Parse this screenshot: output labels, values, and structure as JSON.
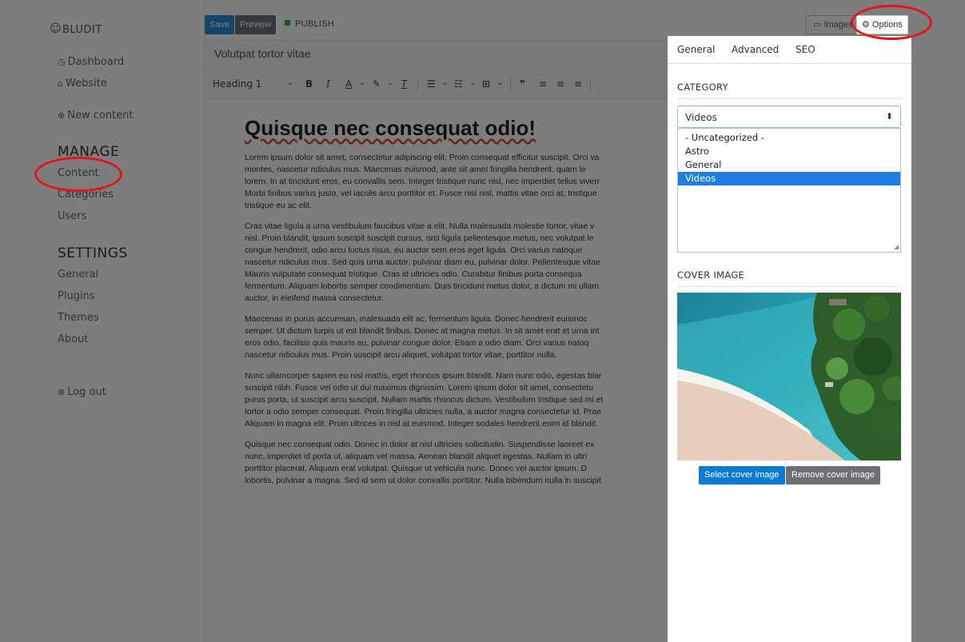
{
  "sidebar": {
    "brand": "BLUDIT",
    "dashboard": "Dashboard",
    "website": "Website",
    "new_content": "New content",
    "manage_heading": "MANAGE",
    "content": "Content",
    "categories": "Categories",
    "users": "Users",
    "settings_heading": "SETTINGS",
    "general": "General",
    "plugins": "Plugins",
    "themes": "Themes",
    "about": "About",
    "logout": "Log out"
  },
  "editor": {
    "save_label": "Save",
    "preview_label": "Preview",
    "publish_label": "PUBLISH",
    "title_value": "Volutpat tortor vitae",
    "heading_format": "Heading 1",
    "doc_heading": "Quisque nec consequat odio!",
    "paragraphs": [
      [
        "Lorem ipsum dolor sit amet, consectetur adipiscing elit. Proin consequat efficitur suscipit. Orci va",
        "montes, nascetur ridiculus mus. Maecenas euismod, ante sit amet fringilla hendrerit, quam le",
        "lorem. In at tincidunt eros, eu convallis sem. Integer tristique nunc nisl, nec imperdiet tellus viverr",
        "Morbi finibus varius justo, vel iaculis arcu porttitor et. Fusce nisi nisl, mattis vitae orci at, tristique",
        "tristique eu ac elit."
      ],
      [
        "Cras vitae ligula a urna vestibulum faucibus vitae a elit. Nulla malesuada molestie tortor, vitae v",
        "nisl. Proin blandit, ipsum suscipit suscipit cursus, orci ligula pellentesque metus, nec volutpat le",
        "congue hendrerit, odio arcu luctus risus, eu auctor sem eros eget ligula. Orci varius natoque",
        "nascetur ridiculus mus. Sed quis urna auctor, pulvinar diam eu, pulvinar dolor. Pellentesque vitae",
        "Mauris vulputate consequat tristique. Cras id ultricies odio. Curabitur finibus porta consequa",
        "fermentum. Aliquam lobortis semper condimentum. Duis tincidunt metus dolor, a dictum mi ullam",
        "auctor, in eleifend massa consectetur."
      ],
      [
        "Maecenas in purus accumsan, malesuada elit ac, fermentum ligula. Donec hendrerit euismoc",
        "semper. Ut dictum turpis ut est blandit finibus. Donec at magna metus. In sit amet erat et urna int",
        "eros odio, facilisis quis mauris eu, pulvinar congue dolor. Etiam a odio diam. Orci varius natoq",
        "nascetur ridiculus mus. Proin suscipit arcu aliquet, volutpat tortor vitae, porttitor nulla."
      ],
      [
        "Nunc ullamcorper sapien eu nisl mattis, eget rhoncus ipsum blandit. Nam nunc odio, egestas blar",
        "suscipit nibh. Fusce vel odio ut dui maximus dignissim. Lorem ipsum dolor sit amet, consectetu",
        "purus porta, ut suscipit arcu suscipit. Nullam mattis rhoncus dictum. Vestibulum tristique sed mi et",
        "tortor a odio semper consequat. Proin fringilla ultricies nulla, a auctor magna consectetur id. Prae",
        "Aliquam in magna elit. Proin ultrices in nisl at euismod. Integer sodales hendrerit enim id blandit."
      ],
      [
        "Quisque nec consequat odio. Donec in dolor at nisl ultricies sollicitudin. Suspendisse laoreet ex",
        "nunc, imperdiet id porta ut, aliquam vel massa. Aenean blandit aliquet egestas. Nullam in ultri",
        "porttitor placerat. Aliquam erat volutpat. Quisque ut vehicula nunc. Donec vel auctor ipsum. D",
        "lobortis, pulvinar a magna. Sed id sem ut dolor convallis porttitor. Nulla bibendum nulla in suscipit"
      ]
    ]
  },
  "topright": {
    "images_label": "Images",
    "options_label": "Options"
  },
  "panel": {
    "tabs": [
      "General",
      "Advanced",
      "SEO"
    ],
    "category_heading": "CATEGORY",
    "category_selected": "Videos",
    "category_options": [
      "- Uncategorized -",
      "Astro",
      "General",
      "Videos"
    ],
    "cover_heading": "COVER IMAGE",
    "select_cover": "Select cover image",
    "remove_cover": "Remove cover image"
  },
  "colors": {
    "primary": "#0a7ad3",
    "secondary": "#6d6f73",
    "annotation": "#e3141b",
    "overlay": "rgba(0,0,0,0.51)"
  }
}
